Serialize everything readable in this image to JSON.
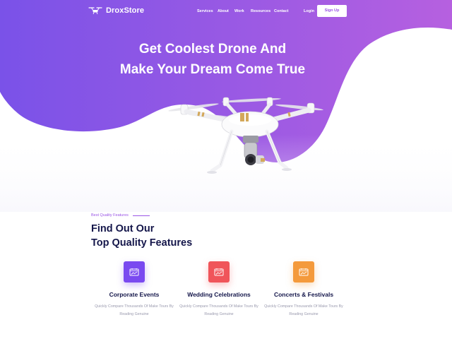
{
  "brand": {
    "name": "DroxStore"
  },
  "nav": {
    "items": [
      {
        "label": "Services"
      },
      {
        "label": "About"
      },
      {
        "label": "Work"
      },
      {
        "label": "Resources"
      },
      {
        "label": "Contact"
      }
    ],
    "login_label": "Login",
    "signup_label": "Sign Up"
  },
  "hero": {
    "title_line1": "Get Coolest Drone And",
    "title_line2": "Make Your Dream Come True"
  },
  "features": {
    "kicker": "Best Quality Features",
    "title_line1": "Find Out Our",
    "title_line2": "Top Quality Features",
    "cards": [
      {
        "title": "Corporate Events",
        "desc_line1": "Quickly Compare Thousands Of Make Tours By",
        "desc_line2": "Reading Genuine",
        "icon": "calendar-chart-icon",
        "color": "#7a4af0"
      },
      {
        "title": "Wedding Celebrations",
        "desc_line1": "Quickly Compare Thousands Of Make Tours By",
        "desc_line2": "Reading Genuine",
        "icon": "calendar-chart-icon",
        "color": "#f0555a"
      },
      {
        "title": "Concerts & Festivals",
        "desc_line1": "Quickly Compare Thousands Of Make Tours By",
        "desc_line2": "Reading Genuine",
        "icon": "calendar-chart-icon",
        "color": "#f49a3c"
      }
    ]
  },
  "colors": {
    "gradient_start": "#7a52e8",
    "gradient_end": "#b25ee0",
    "heading": "#14164a",
    "accent": "#9b56e6"
  }
}
